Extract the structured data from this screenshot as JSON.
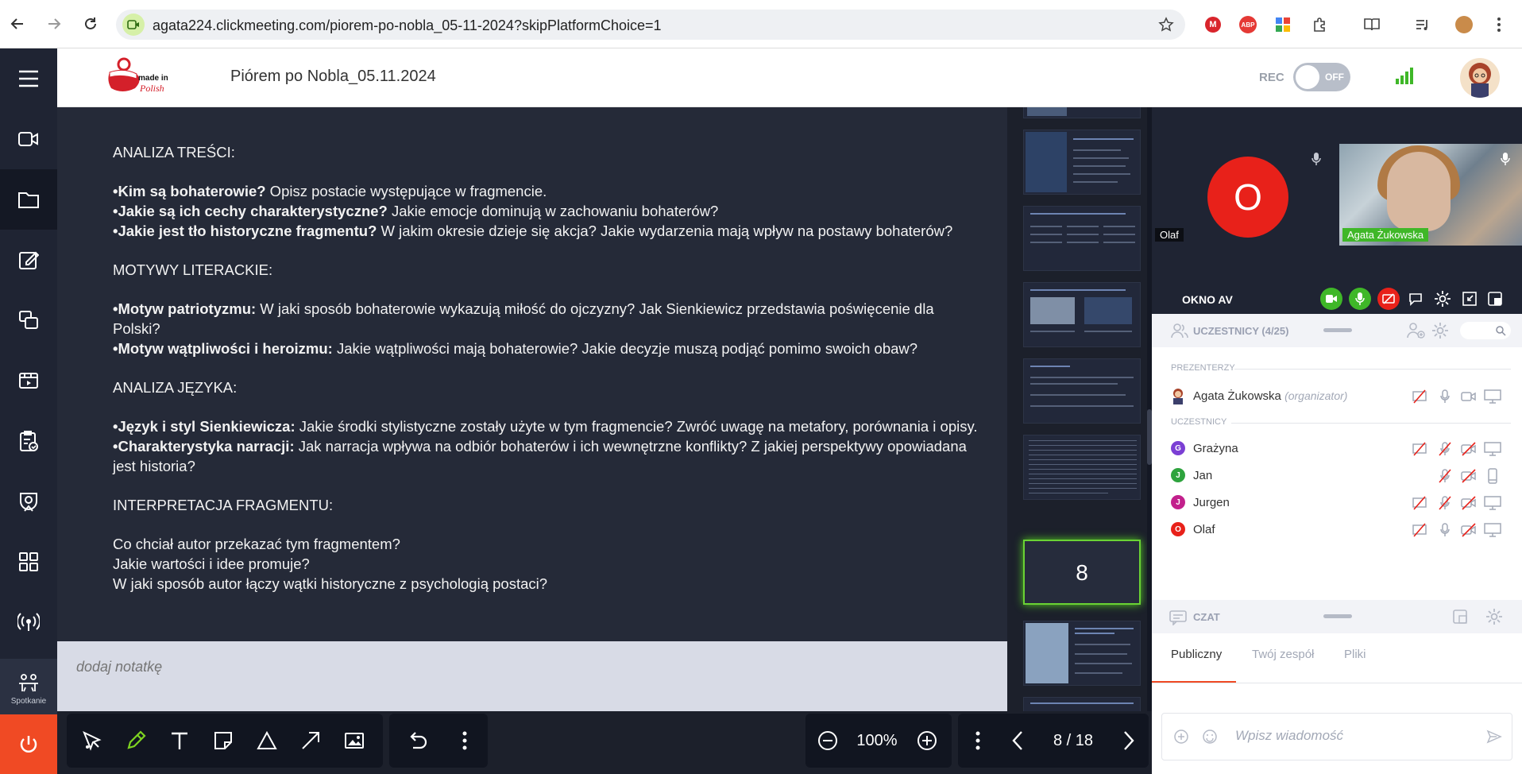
{
  "browser": {
    "url": "agata224.clickmeeting.com/piorem-po-nobla_05-11-2024?skipPlatformChoice=1"
  },
  "header": {
    "logo_text": "made in Polish",
    "meeting_title": "Piórem po Nobla_05.11.2024",
    "rec_label": "REC",
    "rec_state": "OFF"
  },
  "sidebar": {
    "meeting_label": "Spotkanie"
  },
  "slide": {
    "sec1_title": "ANALIZA TREŚCI:",
    "l1_b": "•Kim są bohaterowie?",
    "l1_t": " Opisz postacie występujące w fragmencie.",
    "l2_b": "•Jakie są ich cechy charakterystyczne?",
    "l2_t": " Jakie emocje dominują w zachowaniu bohaterów?",
    "l3_b": "•Jakie jest tło historyczne fragmentu?",
    "l3_t": " W jakim okresie dzieje się akcja? Jakie wydarzenia mają wpływ na postawy bohaterów?",
    "sec2_title": "MOTYWY LITERACKIE:",
    "l4_b": "•Motyw patriotyzmu:",
    "l4_t": " W jaki sposób bohaterowie wykazują miłość do ojczyzny? Jak Sienkiewicz przedstawia poświęcenie dla Polski?",
    "l5_b": "•Motyw wątpliwości i heroizmu:",
    "l5_t": " Jakie wątpliwości mają bohaterowie? Jakie decyzje muszą podjąć pomimo swoich obaw?",
    "sec3_title": "ANALIZA JĘZYKA:",
    "l6_b": "•Język i styl Sienkiewicza:",
    "l6_t": " Jakie środki stylistyczne zostały użyte w tym fragmencie? Zwróć uwagę na metafory, porównania i opisy.",
    "l7_b": "•Charakterystyka narracji:",
    "l7_t": " Jak narracja wpływa na odbiór bohaterów i ich wewnętrzne konflikty? Z jakiej perspektywy opowiadana jest historia?",
    "sec4_title": "INTERPRETACJA FRAGMENTU:",
    "q1": "Co chciał autor przekazać tym fragmentem?",
    "q2": "Jakie wartości i idee promuje?",
    "q3": "W jaki sposób autor łączy wątki historyczne z psychologią postaci?"
  },
  "thumbnails": {
    "active_number": "8"
  },
  "note": {
    "placeholder": "dodaj notatkę"
  },
  "toolbar": {
    "zoom": "100%",
    "page": "8 / 18"
  },
  "video": {
    "olaf_initial": "O",
    "olaf_name": "Olaf",
    "agata_name": "Agata Żukowska"
  },
  "av_panel": {
    "title": "OKNO AV",
    "colors": {
      "green": "#3fb728",
      "red": "#e8211a"
    }
  },
  "participants": {
    "title": "UCZESTNICY (4/25)",
    "presenters_label": "PREZENTERZY",
    "attendees_label": "UCZESTNICY",
    "presenter": {
      "name": "Agata Żukowska",
      "role": "(organizator)"
    },
    "attendees": [
      {
        "initial": "G",
        "name": "Grażyna",
        "color": "#7b3fd4"
      },
      {
        "initial": "J",
        "name": "Jan",
        "color": "#2ea33d"
      },
      {
        "initial": "J",
        "name": "Jurgen",
        "color": "#c2208c"
      },
      {
        "initial": "O",
        "name": "Olaf",
        "color": "#e8211a"
      }
    ]
  },
  "chat": {
    "title": "CZAT",
    "tabs": [
      "Publiczny",
      "Twój zespół",
      "Pliki"
    ],
    "input_placeholder": "Wpisz wiadomość"
  }
}
